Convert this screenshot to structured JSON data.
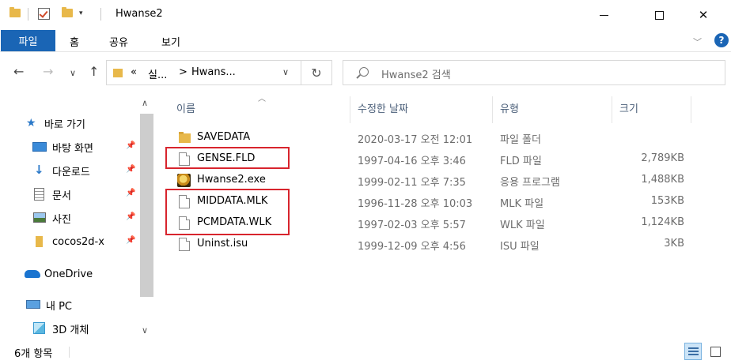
{
  "window": {
    "title": "Hwanse2",
    "controls": {
      "minimize_icon": "minimize-icon",
      "maximize_icon": "maximize-icon",
      "close": "✕"
    }
  },
  "ribbon": {
    "tabs": [
      "파일",
      "홈",
      "공유",
      "보기"
    ],
    "help": "?"
  },
  "nav": {
    "back": "←",
    "forward": "→",
    "recent": "∨",
    "up": "↑",
    "address": {
      "overflow": "«",
      "segment1": "실...",
      "arrow": ">",
      "segment2": "Hwans..."
    },
    "refresh": "↻",
    "search_placeholder": "Hwanse2 검색"
  },
  "sidebar": {
    "quick_access": "바로 가기",
    "items": [
      {
        "label": "바탕 화면",
        "icon": "desktop-icon",
        "pinned": true
      },
      {
        "label": "다운로드",
        "icon": "download-icon",
        "pinned": true
      },
      {
        "label": "문서",
        "icon": "documents-icon",
        "pinned": true
      },
      {
        "label": "사진",
        "icon": "pictures-icon",
        "pinned": true
      },
      {
        "label": "cocos2d-x",
        "icon": "folder-icon",
        "pinned": true
      }
    ],
    "onedrive": "OneDrive",
    "this_pc": "내 PC",
    "objects_3d": "3D 개체"
  },
  "columns": {
    "name": "이름",
    "date": "수정한 날짜",
    "type": "유형",
    "size": "크기"
  },
  "files": [
    {
      "name": "SAVEDATA",
      "date": "2020-03-17 오전 12:01",
      "type": "파일 폴더",
      "size": "",
      "icon": "folder-icon"
    },
    {
      "name": "GENSE.FLD",
      "date": "1997-04-16 오후 3:46",
      "type": "FLD 파일",
      "size": "2,789KB",
      "icon": "file-icon"
    },
    {
      "name": "Hwanse2.exe",
      "date": "1999-02-11 오후 7:35",
      "type": "응용 프로그램",
      "size": "1,488KB",
      "icon": "exe-icon"
    },
    {
      "name": "MIDDATA.MLK",
      "date": "1996-11-28 오후 10:03",
      "type": "MLK 파일",
      "size": "153KB",
      "icon": "file-icon"
    },
    {
      "name": "PCMDATA.WLK",
      "date": "1997-02-03 오후 5:57",
      "type": "WLK 파일",
      "size": "1,124KB",
      "icon": "file-icon"
    },
    {
      "name": "Uninst.isu",
      "date": "1999-12-09 오후 4:56",
      "type": "ISU 파일",
      "size": "3KB",
      "icon": "file-icon"
    }
  ],
  "status": {
    "item_count": "6개 항목"
  },
  "colors": {
    "accent": "#1a65b5",
    "highlight_box": "#d8242d",
    "folder": "#e8b84a"
  }
}
